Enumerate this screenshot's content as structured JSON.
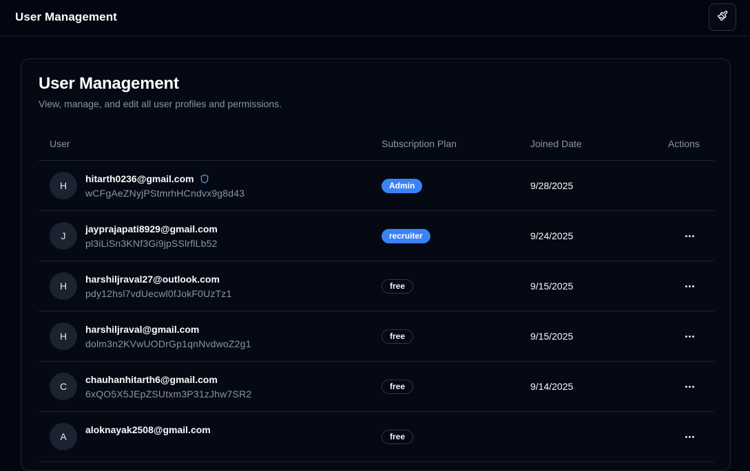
{
  "header": {
    "title": "User Management",
    "theme_button_icon": "paintbrush-icon"
  },
  "page": {
    "title": "User Management",
    "subtitle": "View, manage, and edit all user profiles and permissions."
  },
  "table": {
    "columns": [
      "User",
      "Subscription Plan",
      "Joined Date",
      "Actions"
    ],
    "rows": [
      {
        "initial": "H",
        "email": "hitarth0236@gmail.com",
        "id": "wCFgAeZNyjPStmrhHCndvx9g8d43",
        "plan": "Admin",
        "plan_style": "blue",
        "date": "9/28/2025",
        "admin_icon": true,
        "actions": false
      },
      {
        "initial": "J",
        "email": "jayprajapati8929@gmail.com",
        "id": "pl3iLiSn3KNf3Gi9jpSSlrflLb52",
        "plan": "recruiter",
        "plan_style": "blue",
        "date": "9/24/2025",
        "admin_icon": false,
        "actions": true
      },
      {
        "initial": "H",
        "email": "harshiljraval27@outlook.com",
        "id": "pdy12hsl7vdUecwl0fJokF0UzTz1",
        "plan": "free",
        "plan_style": "outline",
        "date": "9/15/2025",
        "admin_icon": false,
        "actions": true
      },
      {
        "initial": "H",
        "email": "harshiljraval@gmail.com",
        "id": "dolm3n2KVwUODrGp1qnNvdwoZ2g1",
        "plan": "free",
        "plan_style": "outline",
        "date": "9/15/2025",
        "admin_icon": false,
        "actions": true
      },
      {
        "initial": "C",
        "email": "chauhanhitarth6@gmail.com",
        "id": "6xQO5X5JEpZSUtxm3P31zJhw7SR2",
        "plan": "free",
        "plan_style": "outline",
        "date": "9/14/2025",
        "admin_icon": false,
        "actions": true
      },
      {
        "initial": "A",
        "email": "aloknayak2508@gmail.com",
        "id": "",
        "plan": "free",
        "plan_style": "outline",
        "date": "",
        "admin_icon": false,
        "actions": true
      }
    ]
  },
  "colors": {
    "accent": "#3b82f6",
    "background": "#020610",
    "card": "#050913",
    "muted": "#8b95a7"
  }
}
